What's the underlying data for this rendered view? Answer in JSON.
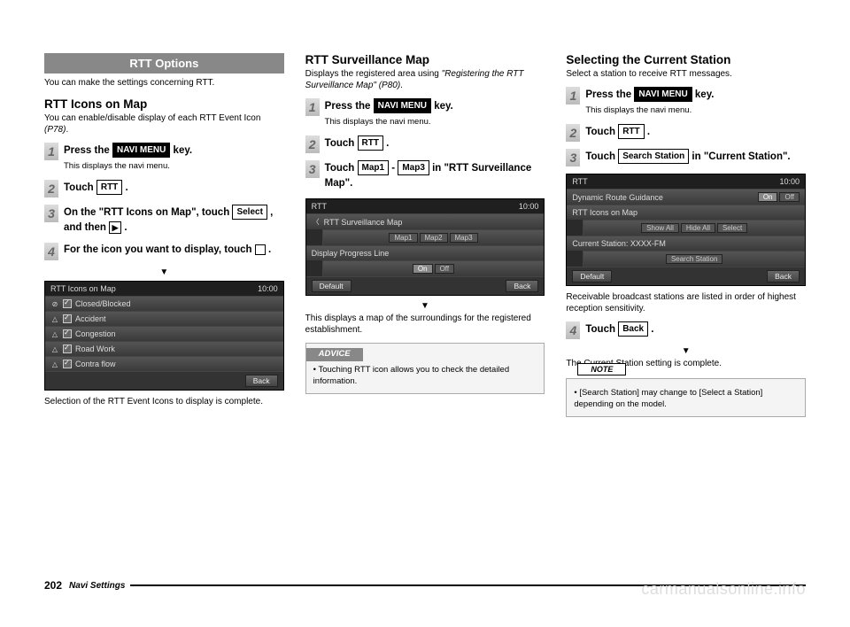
{
  "page": {
    "number": "202",
    "section": "Navi Settings"
  },
  "watermark": "carmanualsonline.info",
  "col1": {
    "header": "RTT Options",
    "intro": "You can make the settings concerning RTT.",
    "sub1_title": "RTT Icons on Map",
    "sub1_desc_a": "You can enable/disable display of each RTT Event Icon ",
    "sub1_desc_b": "(P78)",
    "sub1_desc_c": ".",
    "step1_a": "Press the ",
    "navi_menu": "NAVI MENU",
    "step1_b": " key.",
    "step1_sub": "This displays the navi menu.",
    "step2_a": "Touch ",
    "rtt": "RTT",
    "step2_b": " .",
    "step3_a": "On the \"RTT Icons on Map\", touch ",
    "select": "Select",
    "step3_b": " , and then ",
    "step3_c": " .",
    "step4_a": "For the icon you want to display, touch ",
    "step4_b": " .",
    "screen1": {
      "title": "RTT Icons on Map",
      "time": "10:00",
      "rows": [
        "Closed/Blocked",
        "Accident",
        "Congestion",
        "Road Work",
        "Contra flow"
      ],
      "back": "Back"
    },
    "conclusion": "Selection of the RTT Event Icons to display is complete."
  },
  "col2": {
    "title": "RTT Surveillance Map",
    "desc_a": "Displays the registered area using ",
    "desc_b": "\"Registering the RTT Surveillance Map\" (P80)",
    "desc_c": ".",
    "step1_a": "Press the ",
    "step1_b": " key.",
    "step1_sub": "This displays the navi menu.",
    "step2_a": "Touch ",
    "step2_b": " .",
    "step3_a": "Touch ",
    "map1": "Map1",
    "step3_b": " - ",
    "map3": "Map3",
    "step3_c": " in \"RTT Surveillance Map\".",
    "screen2": {
      "title": "RTT",
      "time": "10:00",
      "row1": "RTT Surveillance Map",
      "maps": [
        "Map1",
        "Map2",
        "Map3"
      ],
      "row2": "Display Progress Line",
      "toggles": [
        "On",
        "Off"
      ],
      "default": "Default",
      "back": "Back"
    },
    "conclusion": "This displays a map of the surroundings for the registered establishment.",
    "advice_label": "ADVICE",
    "advice_text": "Touching RTT icon allows you to check the detailed information."
  },
  "col3": {
    "title": "Selecting the Current Station",
    "desc": "Select a station to receive RTT messages.",
    "step1_a": "Press the ",
    "step1_b": " key.",
    "step1_sub": "This displays the navi menu.",
    "step2_a": "Touch ",
    "step2_b": " .",
    "step3_a": "Touch ",
    "search_station": "Search Station",
    "step3_b": " in \"Current Station\".",
    "screen3": {
      "title": "RTT",
      "time": "10:00",
      "row1": "Dynamic Route Guidance",
      "toggles1": [
        "On",
        "Off"
      ],
      "row2": "RTT Icons on Map",
      "btns": [
        "Show All",
        "Hide All",
        "Select"
      ],
      "row3": "Current Station: XXXX-FM",
      "search": "Search Station",
      "default": "Default",
      "back": "Back"
    },
    "mid_text": "Receivable broadcast stations are listed in order of highest reception sensitivity.",
    "step4_a": "Touch ",
    "back": "Back",
    "step4_b": " .",
    "conclusion": "The Current Station setting is complete.",
    "note_label": "NOTE",
    "note_text": "[Search Station] may change to [Select a Station] depending on the model."
  }
}
